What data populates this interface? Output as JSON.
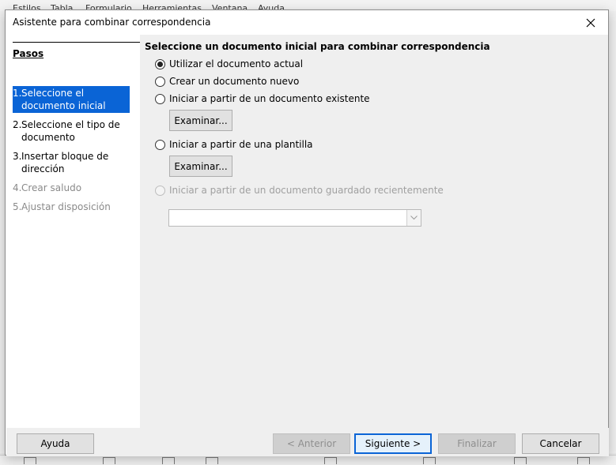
{
  "dialog": {
    "title": "Asistente para combinar correspondencia"
  },
  "background": {
    "menu_fragments": [
      "Estilos",
      "Tabla",
      "Formulario",
      "Herramientas",
      "Ventana",
      "Ayuda"
    ]
  },
  "sidebar": {
    "title": "Pasos",
    "steps": [
      {
        "num": "1.",
        "label": "Seleccione el documento inicial",
        "state": "active"
      },
      {
        "num": "2.",
        "label": "Seleccione el tipo de documento",
        "state": "enabled"
      },
      {
        "num": "3.",
        "label": "Insertar bloque de dirección",
        "state": "enabled"
      },
      {
        "num": "4.",
        "label": "Crear saludo",
        "state": "disabled"
      },
      {
        "num": "5.",
        "label": "Ajustar disposición",
        "state": "disabled"
      }
    ]
  },
  "main": {
    "heading": "Seleccione un documento inicial para combinar correspondencia",
    "options": [
      {
        "label": "Utilizar el documento actual",
        "checked": true
      },
      {
        "label": "Crear un documento nuevo",
        "checked": false
      },
      {
        "label": "Iniciar a partir de un documento existente",
        "checked": false
      },
      {
        "label": "Iniciar a partir de una plantilla",
        "checked": false
      },
      {
        "label": "Iniciar a partir de un documento guardado recientemente",
        "checked": false,
        "disabled": true
      }
    ],
    "browse_label": "Examinar...",
    "recent_combo_value": ""
  },
  "footer": {
    "help": "Ayuda",
    "back": "< Anterior",
    "next": "Siguiente >",
    "finish": "Finalizar",
    "cancel": "Cancelar"
  },
  "colors": {
    "accent": "#0a64d6",
    "panel": "#efefef"
  }
}
